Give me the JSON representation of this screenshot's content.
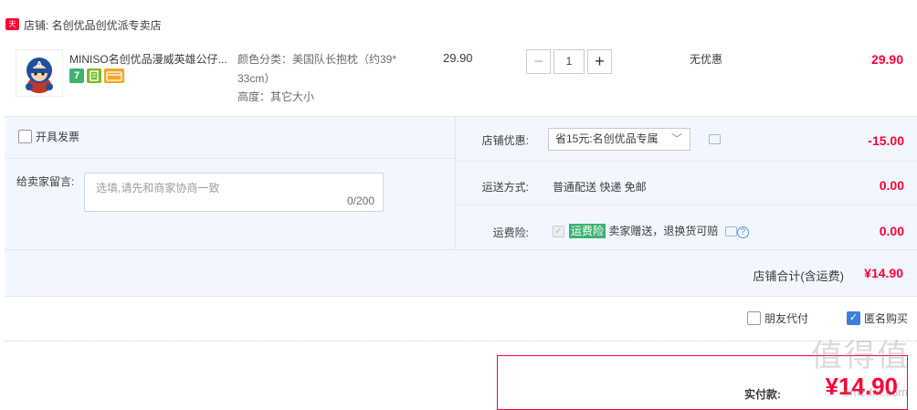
{
  "shop": {
    "badge": "天猫",
    "name": "店铺: 名创优品创优派专卖店"
  },
  "item": {
    "title": "MINISO名创优品漫威英雄公仔...",
    "badges": [
      "7",
      "",
      ""
    ],
    "sku_color": "颜色分类：美国队长抱枕（约39*",
    "sku_color_cont": "33cm）",
    "sku_size": "高度：其它大小",
    "price": "29.90",
    "qty": {
      "minus": "−",
      "value": "1",
      "plus": "+"
    },
    "promo": "无优惠",
    "subtotal": "29.90"
  },
  "invoice": {
    "label": "开具发票"
  },
  "note": {
    "label": "给卖家留言:",
    "placeholder": "选填,请先和商家协商一致",
    "count": "0/200"
  },
  "shop_discount": {
    "label": "店铺优惠:",
    "selected": "省15元:名创优品专属",
    "amount": "-15.00"
  },
  "shipping": {
    "label": "运送方式:",
    "value": "普通配送 快递 免邮",
    "amount": "0.00"
  },
  "insurance": {
    "label": "运费险:",
    "tag": "运费险",
    "text": "卖家赠送，退换货可赔",
    "amount": "0.00"
  },
  "shop_total": {
    "label": "店铺合计(含运费)",
    "value": "¥14.90"
  },
  "options": {
    "friend_pay": "朋友代付",
    "anonymous": "匿名购买"
  },
  "payment": {
    "label": "实付款:",
    "value": "¥14.90"
  },
  "watermark": {
    "main": "值得值",
    "sub": "smzdm.com"
  },
  "colors": {
    "accent": "#ff0036",
    "panel_bg": "#f2f7ff",
    "check_blue": "#3d7ee0"
  }
}
